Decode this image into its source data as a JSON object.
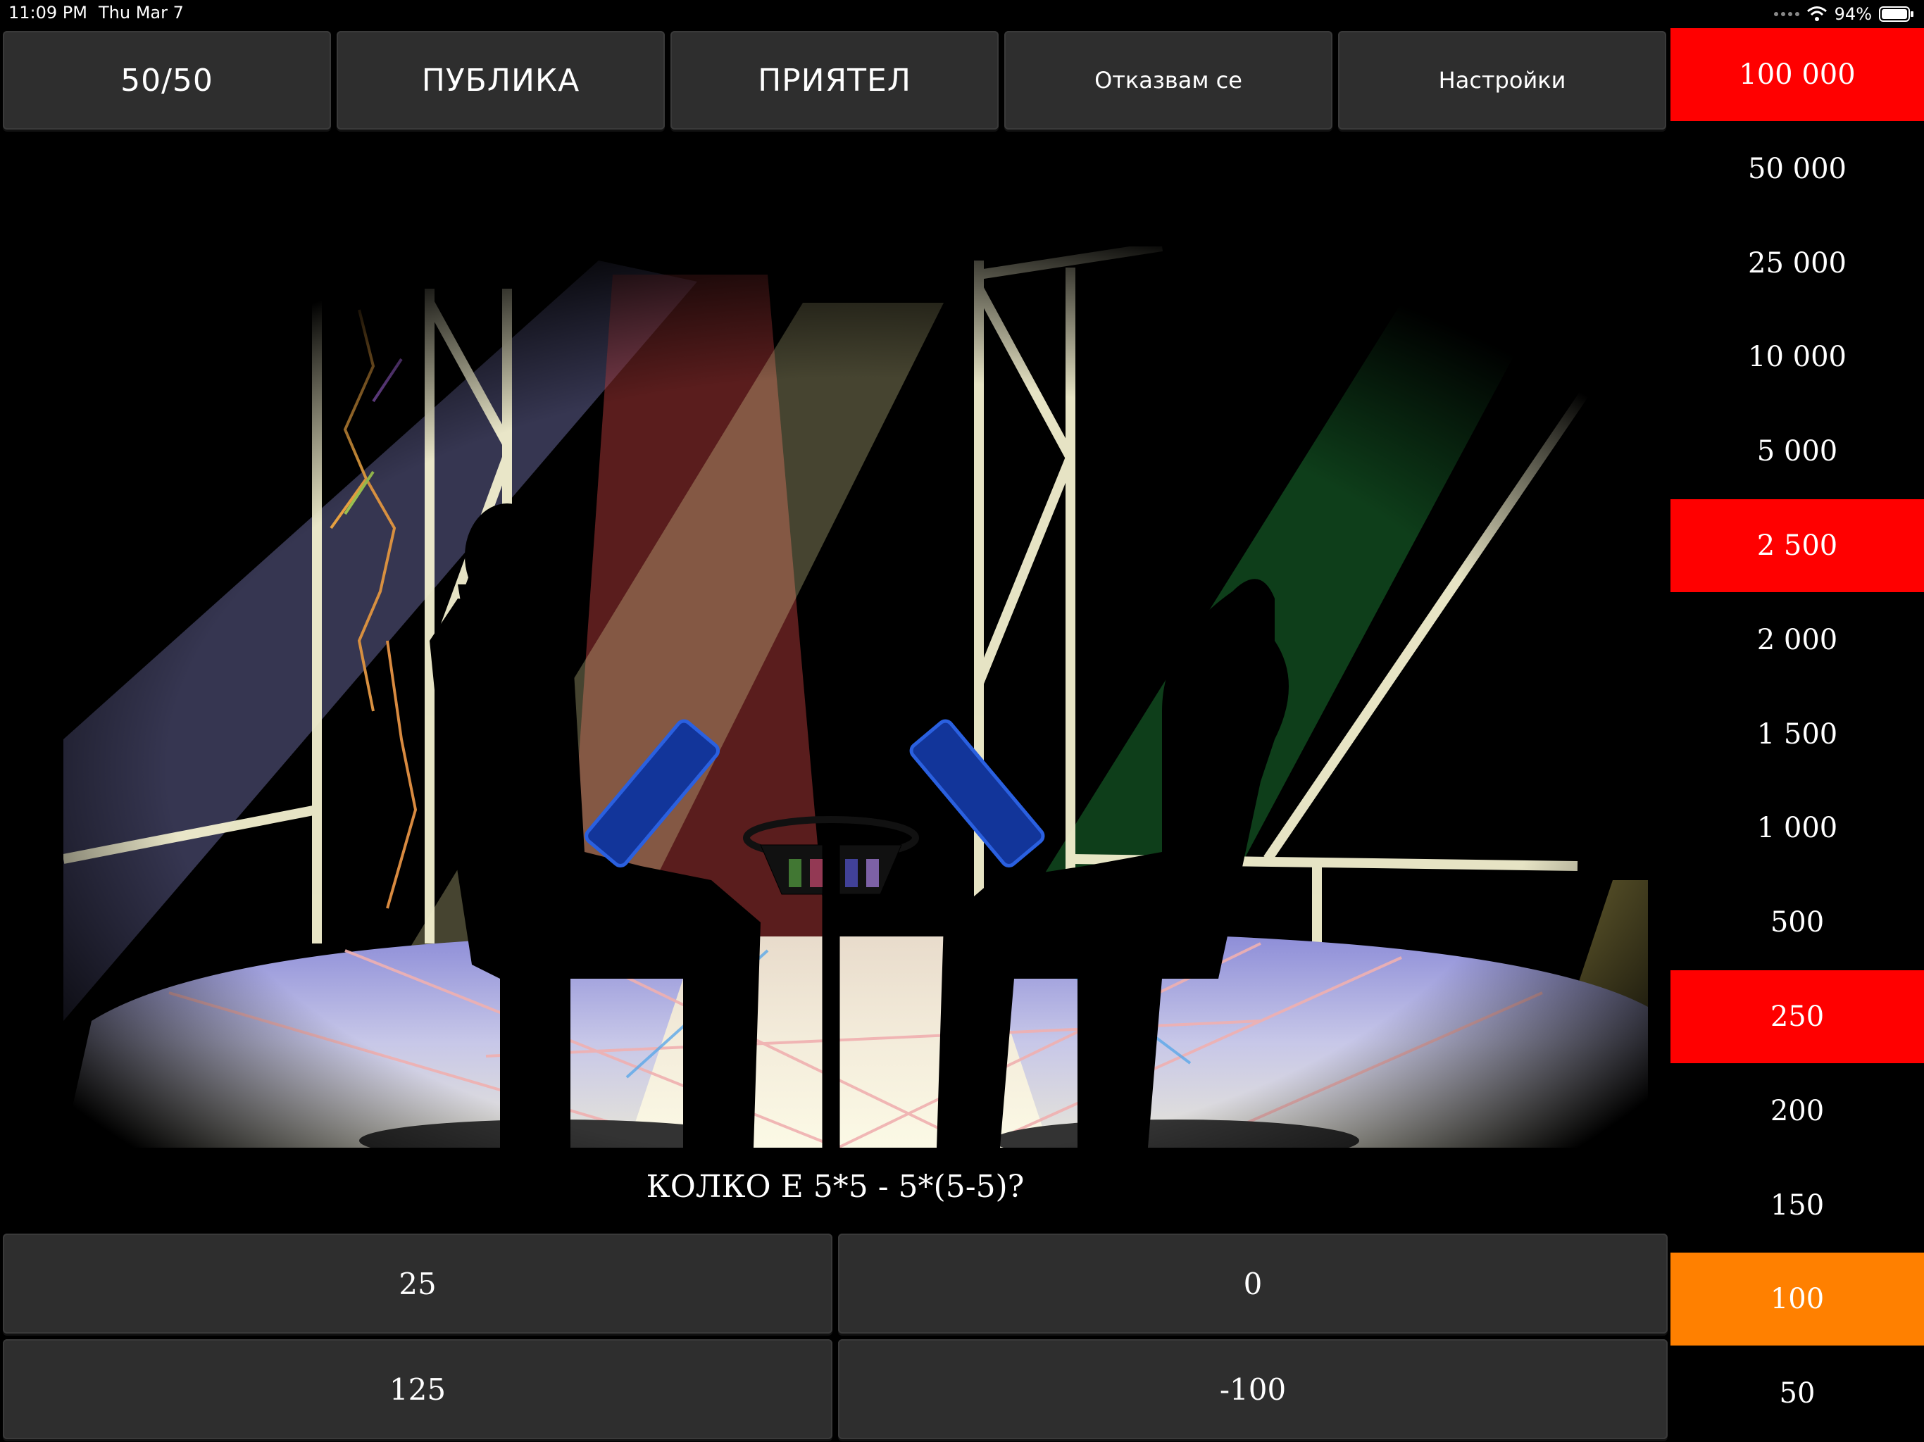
{
  "status_bar": {
    "time": "11:09 PM",
    "date": "Thu Mar 7",
    "battery": "94%"
  },
  "lifelines": {
    "fifty_fifty": "50/50",
    "audience": "ПУБЛИКА",
    "friend": "ПРИЯТЕЛ",
    "walk_away": "Отказвам се",
    "settings": "Настройки"
  },
  "question": {
    "text": "КОЛКО Е 5*5 - 5*(5-5)?"
  },
  "answers": [
    {
      "label": "25"
    },
    {
      "label": "0"
    },
    {
      "label": "125"
    },
    {
      "label": "-100"
    }
  ],
  "prize_ladder": {
    "levels": [
      {
        "value": "100 000",
        "state": "safe"
      },
      {
        "value": "50 000",
        "state": "normal"
      },
      {
        "value": "25 000",
        "state": "normal"
      },
      {
        "value": "10 000",
        "state": "normal"
      },
      {
        "value": "5 000",
        "state": "normal"
      },
      {
        "value": "2 500",
        "state": "safe"
      },
      {
        "value": "2 000",
        "state": "normal"
      },
      {
        "value": "1 500",
        "state": "normal"
      },
      {
        "value": "1 000",
        "state": "normal"
      },
      {
        "value": "500",
        "state": "normal"
      },
      {
        "value": "250",
        "state": "safe"
      },
      {
        "value": "200",
        "state": "normal"
      },
      {
        "value": "150",
        "state": "normal"
      },
      {
        "value": "100",
        "state": "current"
      },
      {
        "value": "50",
        "state": "normal"
      }
    ]
  },
  "colors": {
    "safe": "#ff0000",
    "current": "#ff8000",
    "button": "#2e2e2e",
    "background": "#000000"
  }
}
